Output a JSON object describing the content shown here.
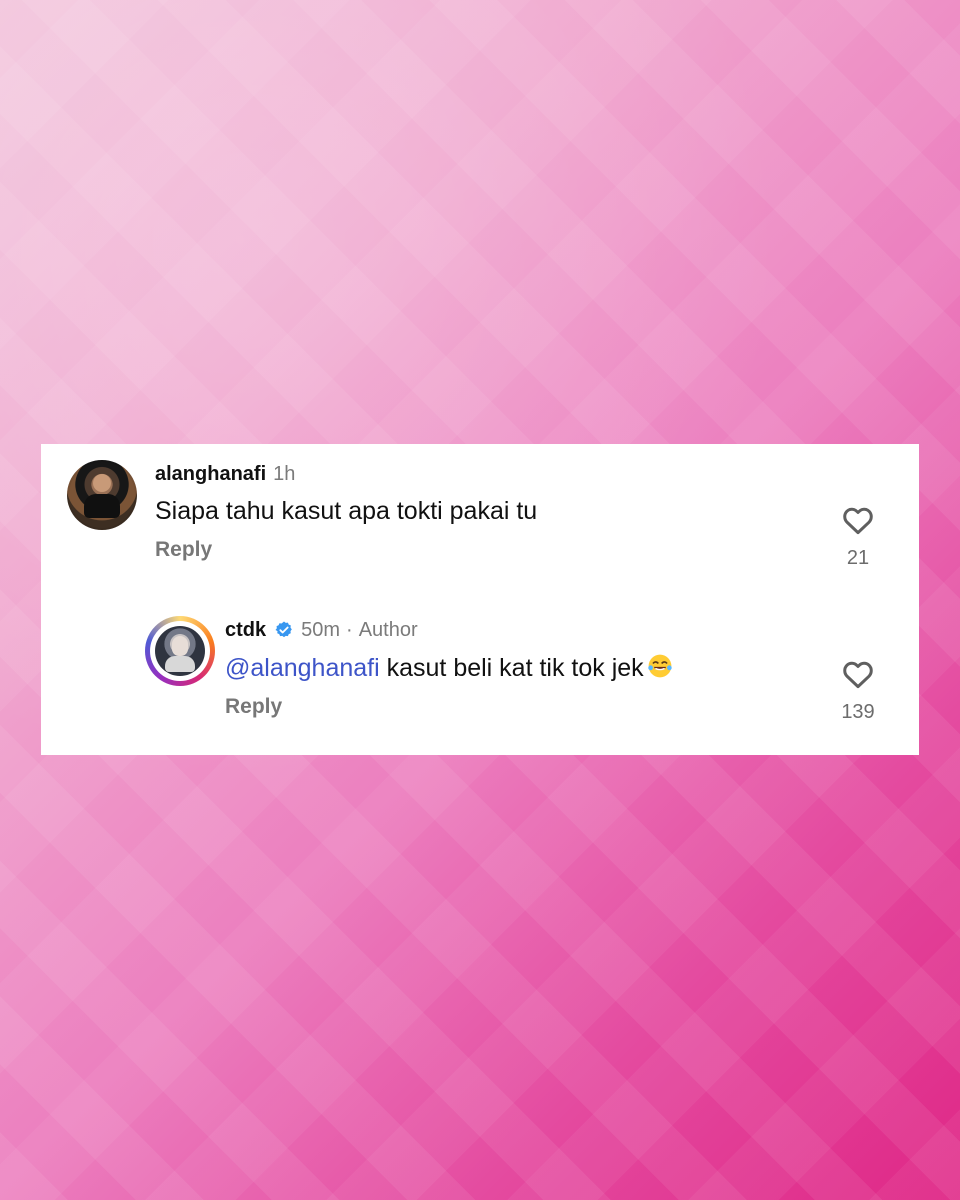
{
  "comments": {
    "top": {
      "username": "alanghanafi",
      "time": "1h",
      "text": "Siapa tahu kasut apa tokti pakai tu",
      "reply_label": "Reply",
      "likes": "21",
      "avatar_icon": "profile-photo-icon"
    },
    "reply": {
      "username": "ctdk",
      "time": "50m",
      "separator": "·",
      "author_label": "Author",
      "mention": "@alanghanafi",
      "text": " kasut beli kat tik tok jek",
      "emoji": "laughing-with-tears-emoji",
      "reply_label": "Reply",
      "likes": "139",
      "avatar_icon": "story-profile-photo-icon",
      "verified_icon": "verified-badge-icon"
    }
  },
  "colors": {
    "background_start": "#f2c6dd",
    "background_end": "#df2786",
    "card": "#ffffff",
    "text": "#111111",
    "muted": "#7b7b7b",
    "mention": "#3d54c8",
    "verified": "#3897f0"
  }
}
